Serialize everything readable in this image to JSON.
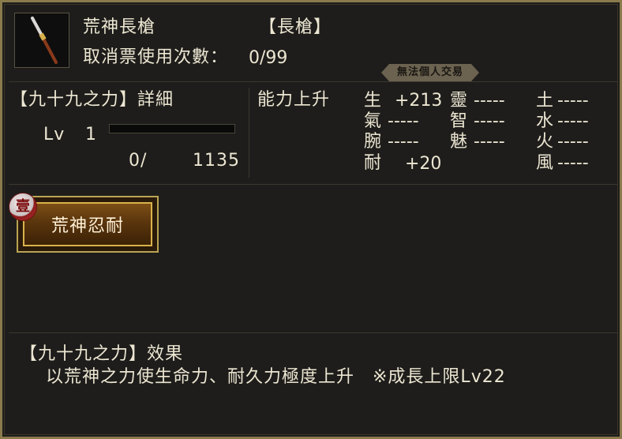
{
  "item": {
    "name": "荒神長槍",
    "type": "【長槍】",
    "cancel_label": "取消票使用次數：",
    "cancel_value": "0/99",
    "icon": "spear-icon"
  },
  "badge": "無法個人交易",
  "power": {
    "title": "【九十九之力】詳細",
    "lv_label": "Lv",
    "lv_value": "1",
    "exp_current": "0/",
    "exp_max": "1135",
    "exp_progress": 0
  },
  "stats": {
    "title": "能力上升",
    "col1": [
      {
        "name": "生",
        "value": "+213"
      },
      {
        "name": "氣",
        "value": "-----"
      },
      {
        "name": "腕",
        "value": "-----"
      },
      {
        "name": "耐",
        "value": "+20"
      }
    ],
    "col2": [
      {
        "name": "靈",
        "value": "-----"
      },
      {
        "name": "智",
        "value": "-----"
      },
      {
        "name": "魅",
        "value": "-----"
      }
    ],
    "col3": [
      {
        "name": "土",
        "value": "-----"
      },
      {
        "name": "水",
        "value": "-----"
      },
      {
        "name": "火",
        "value": "-----"
      },
      {
        "name": "風",
        "value": "-----"
      }
    ]
  },
  "skill": {
    "label": "荒神忍耐",
    "seal": "壹",
    "accent": "#d9b24a"
  },
  "effect": {
    "title": "【九十九之力】效果",
    "text": "以荒神之力使生命力、耐久力極度上升　※成長上限Lv22"
  }
}
